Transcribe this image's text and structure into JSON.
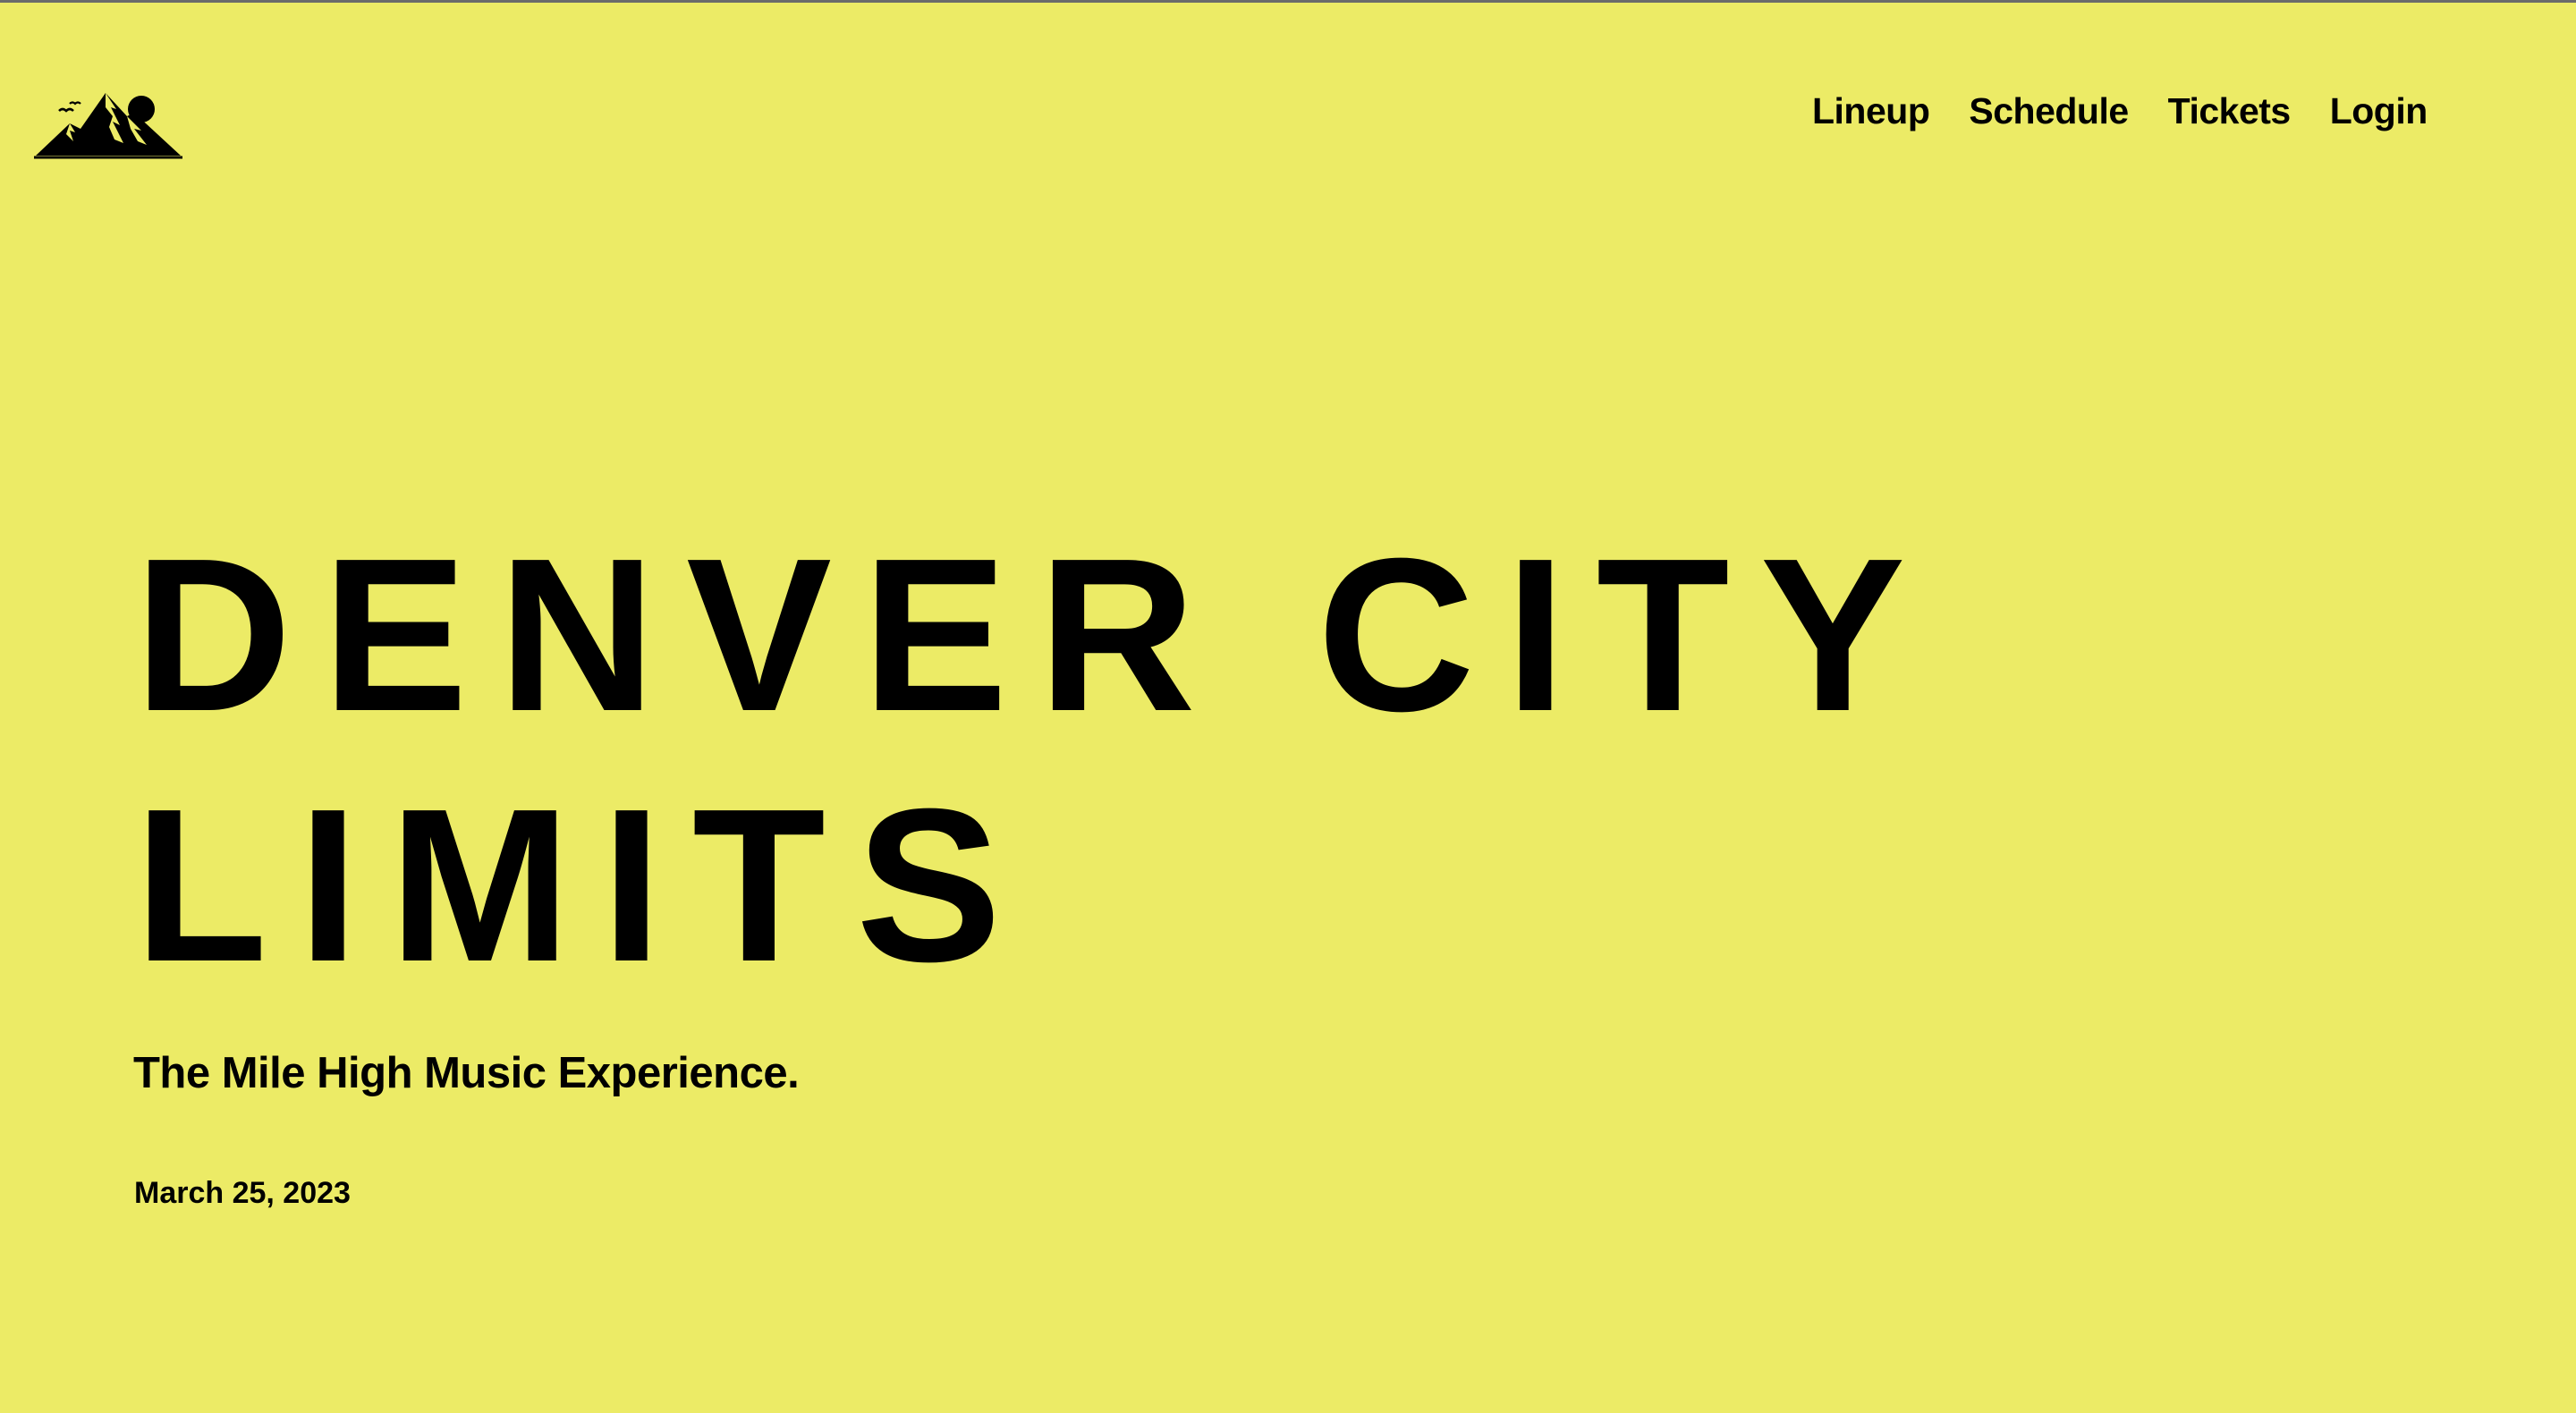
{
  "colors": {
    "background": "#ECEB66",
    "text": "#000000"
  },
  "header": {
    "logo_icon": "mountain-sun-logo-icon",
    "nav": [
      {
        "label": "Lineup"
      },
      {
        "label": "Schedule"
      },
      {
        "label": "Tickets"
      },
      {
        "label": "Login"
      }
    ]
  },
  "hero": {
    "title_line1": "DENVER CITY",
    "title_line2": "LIMITS",
    "tagline": "The Mile High Music Experience.",
    "date": "March 25, 2023"
  }
}
